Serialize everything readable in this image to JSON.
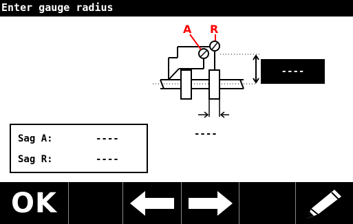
{
  "window": {
    "title": "Enter gauge radius"
  },
  "diagram": {
    "label_a": "A",
    "label_r": "R",
    "label_color": "#ff0000"
  },
  "gauge_radius_value": "----",
  "gap_value": "----",
  "sag": {
    "a_label": "Sag A:",
    "a_value": "----",
    "r_label": "Sag R:",
    "r_value": "----"
  },
  "toolbar": {
    "ok_label": "OK",
    "buttons": [
      "ok-button",
      "empty-button",
      "left-arrow-button",
      "right-arrow-button",
      "empty-button",
      "edit-pencil-button"
    ]
  }
}
